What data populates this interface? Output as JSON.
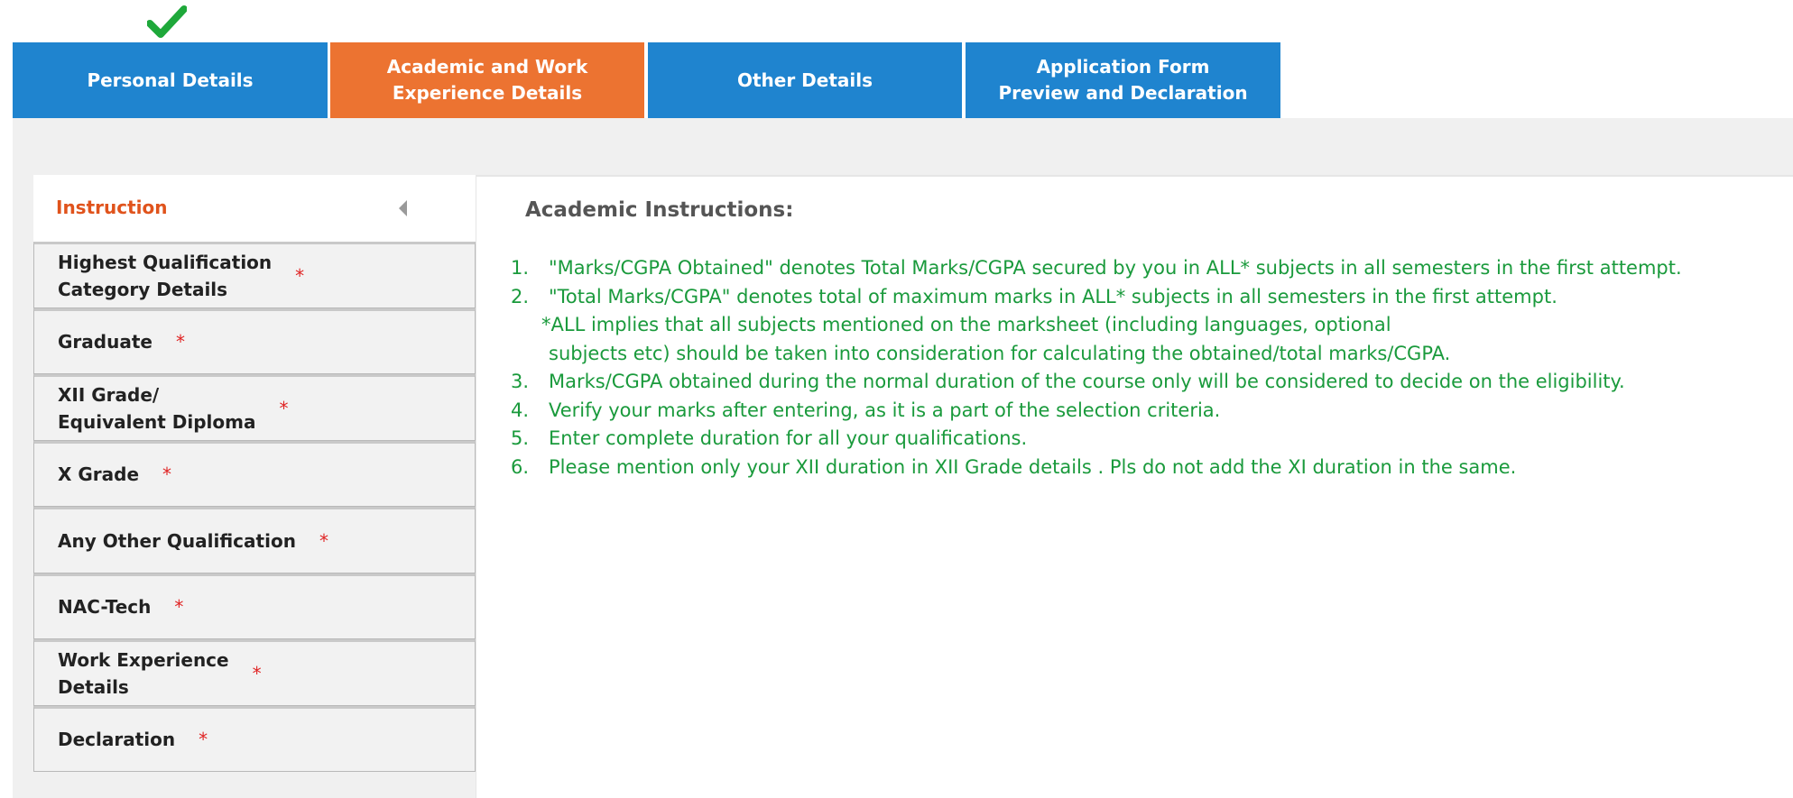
{
  "tabs": [
    {
      "label": "Personal Details",
      "completed": true
    },
    {
      "label": "Academic and Work Experience Details",
      "line1": "Academic and Work",
      "line2": "Experience Details",
      "active": true
    },
    {
      "label": "Other Details"
    },
    {
      "label": "Application Form Preview and Declaration",
      "line1": "Application Form",
      "line2": "Preview and Declaration"
    }
  ],
  "sidebar": {
    "header": "Instruction",
    "required_mark": "*",
    "items": [
      {
        "line1": "Highest Qualification",
        "line2": "Category Details"
      },
      {
        "line1": "Graduate",
        "line2": ""
      },
      {
        "line1": "XII Grade/",
        "line2": "Equivalent Diploma"
      },
      {
        "line1": "X Grade",
        "line2": ""
      },
      {
        "line1": "Any Other Qualification",
        "line2": ""
      },
      {
        "line1": "NAC-Tech",
        "line2": ""
      },
      {
        "line1": "Work Experience",
        "line2": "Details"
      },
      {
        "line1": "Declaration",
        "line2": ""
      }
    ]
  },
  "main": {
    "title": "Academic Instructions:",
    "instructions": [
      {
        "num": "1.",
        "text": "\"Marks/CGPA Obtained\" denotes Total Marks/CGPA secured by you in ALL* subjects in all semesters in the first attempt."
      },
      {
        "num": "2.",
        "text": "\"Total Marks/CGPA\" denotes total of maximum marks in ALL* subjects in all semesters in the first attempt."
      },
      {
        "num": "3.",
        "text": "Marks/CGPA obtained during the normal duration of the course only will be considered to decide on the eligibility."
      },
      {
        "num": "4.",
        "text": "Verify your marks after entering, as it is a part of the selection criteria."
      },
      {
        "num": "5.",
        "text": "Enter complete duration for all your qualifications."
      },
      {
        "num": "6.",
        "text": "Please mention only your XII duration in XII Grade details . Pls do not add the XI duration in the same."
      }
    ],
    "note_line1": "*ALL implies that all subjects mentioned on the marksheet (including languages, optional",
    "note_line2": "subjects etc) should be taken into consideration for calculating the obtained/total marks/CGPA."
  },
  "colors": {
    "tab_blue": "#1f84cf",
    "tab_orange": "#ec7331",
    "instruction_green": "#1a9a3c",
    "header_orange": "#e0531c",
    "required_red": "#e02424",
    "check_green": "#1ea83a"
  }
}
